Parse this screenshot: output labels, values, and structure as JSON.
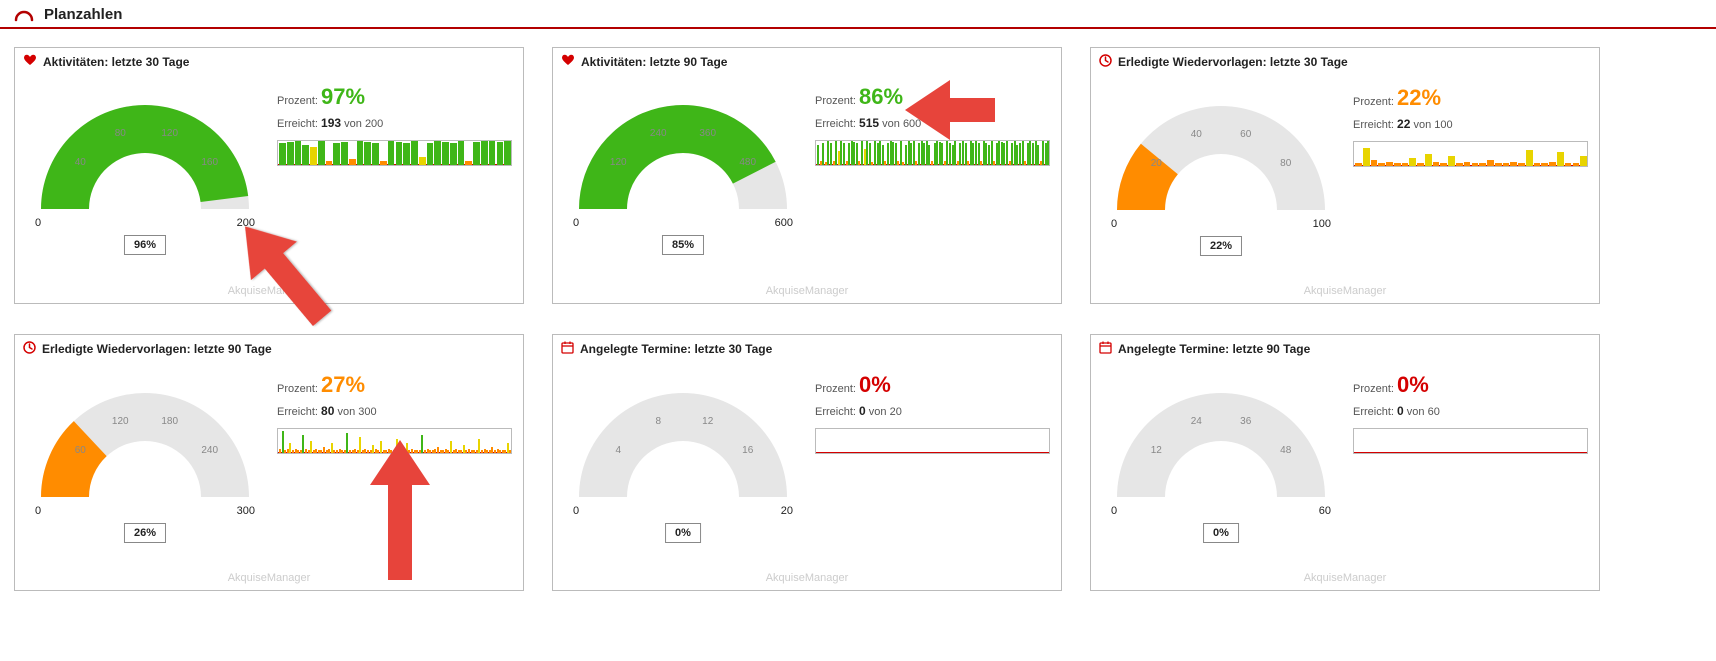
{
  "section_title": "Planzahlen",
  "watermark": "AkquiseManager",
  "prozent_label": "Prozent:",
  "erreicht_label": "Erreicht:",
  "von_label": "von",
  "cards": [
    {
      "id": "act30",
      "icon": "heart",
      "title": "Aktivitäten: letzte 30 Tage",
      "percent": "97%",
      "percent_class": "pct-green",
      "reached": "193",
      "target": "200",
      "gauge_pct": 96,
      "gauge_label": "96%",
      "gauge_max": 200,
      "gauge_color": "#3fb618",
      "axis_min": "0",
      "axis_max": "200",
      "ticks": [
        {
          "v": 40
        },
        {
          "v": 80
        },
        {
          "v": 120
        },
        {
          "v": 160
        }
      ],
      "spark": [
        22,
        23,
        24,
        20,
        18,
        24,
        4,
        22,
        23,
        6,
        24,
        23,
        22,
        4,
        24,
        23,
        22,
        24,
        8,
        22,
        24,
        23,
        22,
        24,
        4,
        23,
        24,
        24,
        23,
        24
      ],
      "spark_palette": [
        "g",
        "g",
        "g",
        "g",
        "y",
        "g",
        "o",
        "g",
        "g",
        "o",
        "g",
        "g",
        "g",
        "o",
        "g",
        "g",
        "g",
        "g",
        "y",
        "g",
        "g",
        "g",
        "g",
        "g",
        "o",
        "g",
        "g",
        "g",
        "g",
        "g"
      ]
    },
    {
      "id": "act90",
      "icon": "heart",
      "title": "Aktivitäten: letzte 90 Tage",
      "percent": "86%",
      "percent_class": "pct-green",
      "reached": "515",
      "target": "600",
      "gauge_pct": 85,
      "gauge_label": "85%",
      "gauge_max": 600,
      "gauge_color": "#3fb618",
      "axis_min": "0",
      "axis_max": "600",
      "ticks": [
        {
          "v": 120
        },
        {
          "v": 240
        },
        {
          "v": 360
        },
        {
          "v": 480
        }
      ],
      "spark": [
        20,
        4,
        22,
        3,
        24,
        22,
        4,
        24,
        14,
        24,
        22,
        4,
        22,
        24,
        23,
        22,
        4,
        24,
        16,
        24,
        22,
        3,
        24,
        22,
        24,
        20,
        4,
        22,
        24,
        23,
        22,
        4,
        24,
        3,
        20,
        24,
        22,
        24,
        4,
        22,
        24,
        22,
        24,
        20,
        4,
        22,
        24,
        23,
        22,
        4,
        24,
        22,
        20,
        24,
        4,
        22,
        24,
        22,
        4,
        24,
        22,
        24,
        22,
        4,
        24,
        22,
        20,
        24,
        4,
        22,
        24,
        23,
        22,
        24,
        4,
        22,
        24,
        20,
        22,
        24,
        4,
        22,
        24,
        22,
        24,
        20,
        4,
        24,
        22,
        24
      ],
      "spark_palette": [
        "g",
        "o",
        "g",
        "o",
        "g",
        "g",
        "o",
        "g",
        "y",
        "g",
        "g",
        "o",
        "g",
        "g",
        "g",
        "g",
        "o",
        "g",
        "y",
        "g",
        "g",
        "o",
        "g",
        "g",
        "g",
        "g",
        "o",
        "g",
        "g",
        "g",
        "g",
        "o",
        "g",
        "o",
        "g",
        "g",
        "g",
        "g",
        "o",
        "g",
        "g",
        "g",
        "g",
        "g",
        "o",
        "g",
        "g",
        "g",
        "g",
        "o",
        "g",
        "g",
        "g",
        "g",
        "o",
        "g",
        "g",
        "g",
        "o",
        "g",
        "g",
        "g",
        "g",
        "o",
        "g",
        "g",
        "g",
        "g",
        "o",
        "g",
        "g",
        "g",
        "g",
        "g",
        "o",
        "g",
        "g",
        "g",
        "g",
        "g",
        "o",
        "g",
        "g",
        "g",
        "g",
        "g",
        "o",
        "g",
        "g",
        "g"
      ]
    },
    {
      "id": "wv30",
      "icon": "clock",
      "title": "Erledigte Wiedervorlagen: letzte 30 Tage",
      "percent": "22%",
      "percent_class": "pct-orange",
      "reached": "22",
      "target": "100",
      "gauge_pct": 22,
      "gauge_label": "22%",
      "gauge_max": 100,
      "gauge_color": "#ff8c00",
      "axis_min": "0",
      "axis_max": "100",
      "ticks": [
        {
          "v": 20
        },
        {
          "v": 40
        },
        {
          "v": 60
        },
        {
          "v": 80
        }
      ],
      "spark": [
        3,
        18,
        6,
        3,
        4,
        3,
        3,
        8,
        3,
        12,
        4,
        3,
        10,
        3,
        4,
        3,
        3,
        6,
        3,
        3,
        4,
        3,
        16,
        3,
        3,
        4,
        14,
        3,
        3,
        10
      ],
      "spark_palette": [
        "o",
        "y",
        "o",
        "o",
        "o",
        "o",
        "o",
        "y",
        "o",
        "y",
        "o",
        "o",
        "y",
        "o",
        "o",
        "o",
        "o",
        "o",
        "o",
        "o",
        "o",
        "o",
        "y",
        "o",
        "o",
        "o",
        "y",
        "o",
        "o",
        "y"
      ]
    },
    {
      "id": "wv90",
      "icon": "clock",
      "title": "Erledigte Wiedervorlagen: letzte 90 Tage",
      "percent": "27%",
      "percent_class": "pct-orange",
      "reached": "80",
      "target": "300",
      "gauge_pct": 26,
      "gauge_label": "26%",
      "gauge_max": 300,
      "gauge_color": "#ff8c00",
      "axis_min": "0",
      "axis_max": "300",
      "ticks": [
        {
          "v": 60
        },
        {
          "v": 120
        },
        {
          "v": 180
        },
        {
          "v": 240
        }
      ],
      "spark": [
        4,
        22,
        3,
        4,
        10,
        3,
        4,
        3,
        3,
        18,
        4,
        3,
        12,
        3,
        4,
        3,
        3,
        6,
        3,
        4,
        10,
        3,
        3,
        4,
        3,
        3,
        20,
        3,
        3,
        4,
        3,
        16,
        3,
        4,
        3,
        3,
        8,
        4,
        3,
        12,
        3,
        3,
        4,
        3,
        3,
        14,
        3,
        4,
        3,
        10,
        3,
        4,
        3,
        3,
        3,
        18,
        3,
        4,
        3,
        3,
        4,
        6,
        3,
        3,
        4,
        3,
        12,
        3,
        4,
        3,
        3,
        8,
        3,
        4,
        3,
        3,
        3,
        14,
        3,
        4,
        3,
        3,
        6,
        3,
        4,
        3,
        3,
        3,
        10,
        3
      ],
      "spark_palette": [
        "o",
        "g",
        "o",
        "o",
        "y",
        "o",
        "o",
        "o",
        "o",
        "g",
        "o",
        "o",
        "y",
        "o",
        "o",
        "o",
        "o",
        "o",
        "o",
        "o",
        "y",
        "o",
        "o",
        "o",
        "o",
        "o",
        "g",
        "o",
        "o",
        "o",
        "o",
        "y",
        "o",
        "o",
        "o",
        "o",
        "y",
        "o",
        "o",
        "y",
        "o",
        "o",
        "o",
        "o",
        "o",
        "y",
        "o",
        "o",
        "o",
        "y",
        "o",
        "o",
        "o",
        "o",
        "o",
        "g",
        "o",
        "o",
        "o",
        "o",
        "o",
        "o",
        "o",
        "o",
        "o",
        "o",
        "y",
        "o",
        "o",
        "o",
        "o",
        "y",
        "o",
        "o",
        "o",
        "o",
        "o",
        "y",
        "o",
        "o",
        "o",
        "o",
        "o",
        "o",
        "o",
        "o",
        "o",
        "o",
        "y",
        "o"
      ]
    },
    {
      "id": "term30",
      "icon": "calendar",
      "title": "Angelegte Termine: letzte 30 Tage",
      "percent": "0%",
      "percent_class": "pct-red",
      "reached": "0",
      "target": "20",
      "gauge_pct": 0,
      "gauge_label": "0%",
      "gauge_max": 20,
      "gauge_color": "#ff8c00",
      "axis_min": "0",
      "axis_max": "20",
      "ticks": [
        {
          "v": 4
        },
        {
          "v": 8
        },
        {
          "v": 12
        },
        {
          "v": 16
        }
      ],
      "spark": [],
      "spark_palette": []
    },
    {
      "id": "term90",
      "icon": "calendar",
      "title": "Angelegte Termine: letzte 90 Tage",
      "percent": "0%",
      "percent_class": "pct-red",
      "reached": "0",
      "target": "60",
      "gauge_pct": 0,
      "gauge_label": "0%",
      "gauge_max": 60,
      "gauge_color": "#ff8c00",
      "axis_min": "0",
      "axis_max": "60",
      "ticks": [
        {
          "v": 12
        },
        {
          "v": 24
        },
        {
          "v": 36
        },
        {
          "v": 48
        }
      ],
      "spark": [],
      "spark_palette": []
    }
  ],
  "chart_data": [
    {
      "type": "gauge",
      "title": "Aktivitäten: letzte 30 Tage",
      "value": 193,
      "max": 200,
      "percent": 96,
      "display_percent": 97,
      "xlabel": "",
      "ylabel": "",
      "ylim": [
        0,
        200
      ]
    },
    {
      "type": "gauge",
      "title": "Aktivitäten: letzte 90 Tage",
      "value": 515,
      "max": 600,
      "percent": 85,
      "display_percent": 86,
      "xlabel": "",
      "ylabel": "",
      "ylim": [
        0,
        600
      ]
    },
    {
      "type": "gauge",
      "title": "Erledigte Wiedervorlagen: letzte 30 Tage",
      "value": 22,
      "max": 100,
      "percent": 22,
      "display_percent": 22,
      "xlabel": "",
      "ylabel": "",
      "ylim": [
        0,
        100
      ]
    },
    {
      "type": "gauge",
      "title": "Erledigte Wiedervorlagen: letzte 90 Tage",
      "value": 80,
      "max": 300,
      "percent": 26,
      "display_percent": 27,
      "xlabel": "",
      "ylabel": "",
      "ylim": [
        0,
        300
      ]
    },
    {
      "type": "gauge",
      "title": "Angelegte Termine: letzte 30 Tage",
      "value": 0,
      "max": 20,
      "percent": 0,
      "display_percent": 0,
      "xlabel": "",
      "ylabel": "",
      "ylim": [
        0,
        20
      ]
    },
    {
      "type": "gauge",
      "title": "Angelegte Termine: letzte 90 Tage",
      "value": 0,
      "max": 60,
      "percent": 0,
      "display_percent": 0,
      "xlabel": "",
      "ylabel": "",
      "ylim": [
        0,
        60
      ]
    }
  ]
}
